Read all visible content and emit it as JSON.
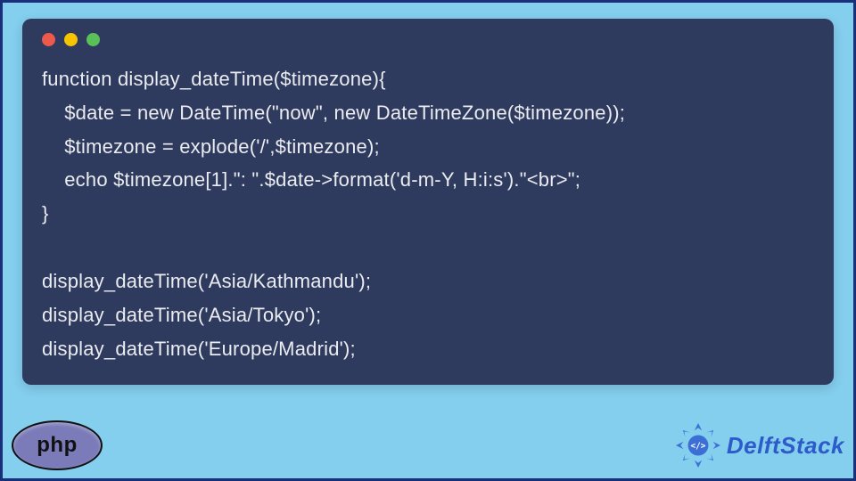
{
  "code": {
    "lines": [
      "function display_dateTime($timezone){",
      "    $date = new DateTime(\"now\", new DateTimeZone($timezone));",
      "    $timezone = explode('/',$timezone);",
      "    echo $timezone[1].\": \".$date->format('d-m-Y, H:i:s').\"<br>\";",
      "}",
      "",
      "display_dateTime('Asia/Kathmandu');",
      "display_dateTime('Asia/Tokyo');",
      "display_dateTime('Europe/Madrid');"
    ]
  },
  "php_badge": "php",
  "brand": "DelftStack"
}
